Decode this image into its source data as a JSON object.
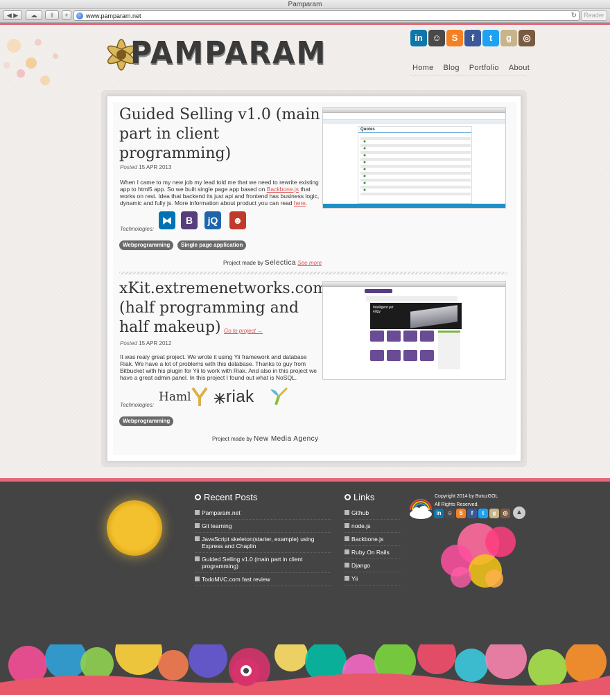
{
  "window": {
    "title": "Pamparam"
  },
  "browser": {
    "url": "www.pamparam.net",
    "reader_label": "Reader",
    "add_tab": "+"
  },
  "header": {
    "logo_text": "PAMPARAM",
    "social": [
      {
        "name": "linkedin-icon",
        "glyph": "in",
        "color": "#0e76a8"
      },
      {
        "name": "github-icon",
        "glyph": "☺",
        "color": "#4a4a4a"
      },
      {
        "name": "stackoverflow-icon",
        "glyph": "S",
        "color": "#f48024"
      },
      {
        "name": "facebook-icon",
        "glyph": "f",
        "color": "#3b5998"
      },
      {
        "name": "twitter-icon",
        "glyph": "t",
        "color": "#1da1f2"
      },
      {
        "name": "goodreads-icon",
        "glyph": "g",
        "color": "#c8b48a"
      },
      {
        "name": "instagram-icon",
        "glyph": "◎",
        "color": "#7a5a40"
      }
    ],
    "nav": [
      "Home",
      "Blog",
      "Portfolio",
      "About"
    ]
  },
  "posts": [
    {
      "title_lines": [
        "Guided Selling v1.0 (main",
        "part in client",
        "programming)"
      ],
      "posted_label": "Posted",
      "date": "15 APR 2013",
      "text_before": "When I came to my new job my lead told me that we need to rewrite existing app to html5 app. So we built single page app based on ",
      "link1": "Backbone.js",
      "text_middle": " that works on rest. Idea that backend its just api and frontend has business logic, dynamic and fully js. More information about product you can read ",
      "link2": "here",
      "text_after": ".",
      "tech_label": "Technologies:",
      "tech": [
        {
          "name": "backbone-icon",
          "glyph": "⧓",
          "color": "#0071b5"
        },
        {
          "name": "bootstrap-icon",
          "glyph": "B",
          "color": "#563d7c"
        },
        {
          "name": "jquery-icon",
          "glyph": "jQ",
          "color": "#1e66a8"
        },
        {
          "name": "grunt-icon",
          "glyph": "☻",
          "color": "#c0392b"
        }
      ],
      "tags": [
        "Webprogramming",
        "Single page application"
      ],
      "made_by_label": "Project made by",
      "company": "Selectica",
      "see_more": "See more"
    },
    {
      "title_lines": [
        "xKit.extremenetworks.com",
        "(half programming and",
        "half makeup)"
      ],
      "go_to_project": "Go to project →",
      "posted_label": "Posted",
      "date": "15 APR 2012",
      "text": "It was realy great project. We wrote it using Yii framework and database Riak. We have a lot of problems with this database. Thanks to guy from Bitbucket with his plugin for Yii to work with Riak. And also in this project we have a great admin panel. In this project I found out what is NoSQL.",
      "tech_label": "Technologies:",
      "tech_words": [
        "Haml",
        "riak"
      ],
      "tags": [
        "Webprogramming"
      ],
      "made_by_label": "Project made by",
      "company": "New Media Agency"
    }
  ],
  "screenshot1": {
    "heading": "Quotes"
  },
  "screenshot2": {
    "headline": "Intelligent yet edgy"
  },
  "footer": {
    "recent_heading": "Recent Posts",
    "recent": [
      "Pamparam.net",
      "Git learning",
      "JavaScript skeleton(starter, example) using Express and Chaplin",
      "Guided Selling v1.0 (main part in client programming)",
      "TodoMVC.com fast review"
    ],
    "links_heading": "Links",
    "links": [
      "Github",
      "node.js",
      "Backbone.js",
      "Ruby On Rails",
      "Django",
      "Yii"
    ],
    "copyright_line1": "Copyright 2014 by ButuzGOL",
    "copyright_line2": "All Rights Reserved.",
    "up_arrow": "▲"
  }
}
